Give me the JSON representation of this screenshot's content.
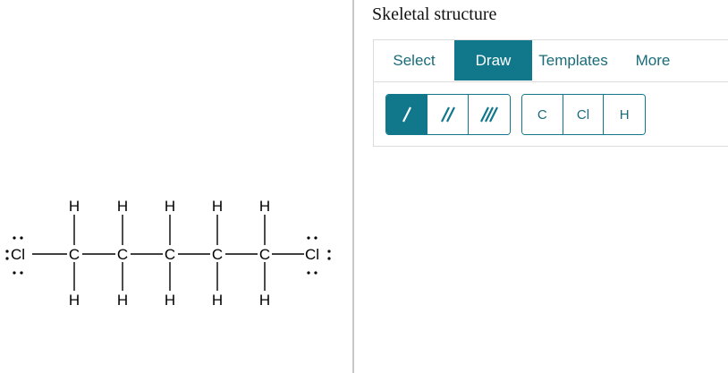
{
  "panel_title": "Skeletal structure",
  "tabs": [
    {
      "label": "Select",
      "active": false
    },
    {
      "label": "Draw",
      "active": true
    },
    {
      "label": "Templates",
      "active": false
    },
    {
      "label": "More",
      "active": false
    }
  ],
  "bond_tools": [
    {
      "name": "single-bond",
      "active": true
    },
    {
      "name": "double-bond",
      "active": false
    },
    {
      "name": "triple-bond",
      "active": false
    }
  ],
  "atom_tools": [
    {
      "label": "C"
    },
    {
      "label": "Cl"
    },
    {
      "label": "H"
    }
  ],
  "molecule": {
    "terminal_atom": "Cl",
    "chain_atom": "C",
    "substituent_atom": "H",
    "chain_length": 5
  },
  "colors": {
    "accent": "#10788a",
    "accent_text": "#1a6b7a",
    "divider": "#c8c8c8"
  }
}
